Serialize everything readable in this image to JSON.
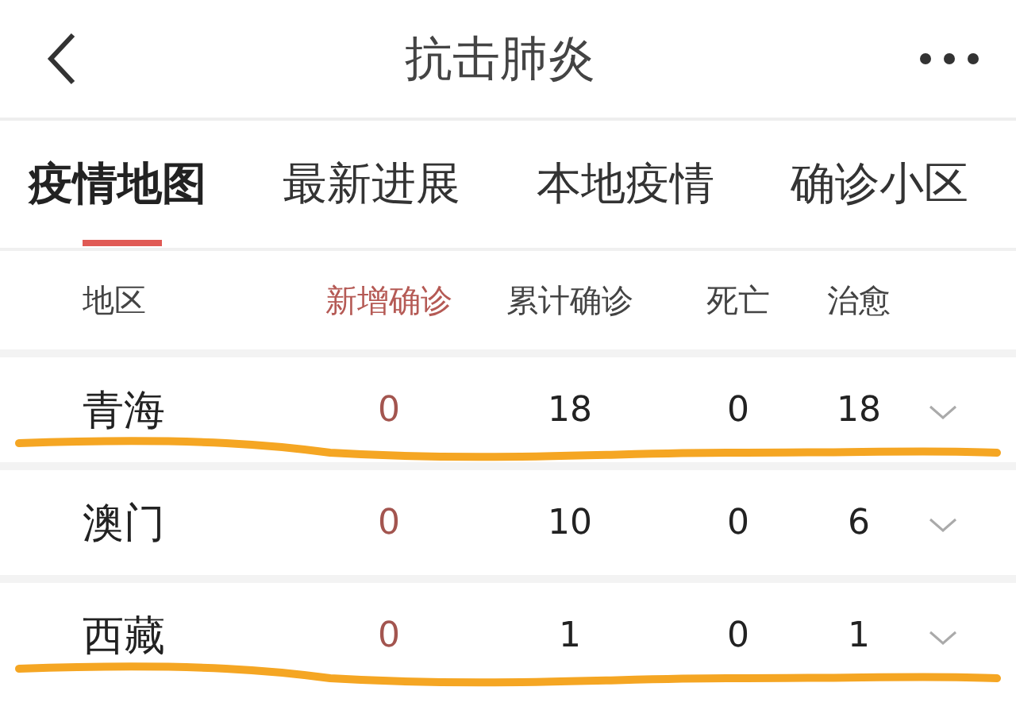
{
  "header": {
    "title": "抗击肺炎"
  },
  "tabs": [
    {
      "label": "疫情地图",
      "selected": true
    },
    {
      "label": "最新进展",
      "selected": false
    },
    {
      "label": "本地疫情",
      "selected": false
    },
    {
      "label": "确诊小区",
      "selected": false
    }
  ],
  "table": {
    "columns": [
      {
        "label": "地区",
        "kind": "plain"
      },
      {
        "label": "新增确诊",
        "kind": "highlight"
      },
      {
        "label": "累计确诊",
        "kind": "plain"
      },
      {
        "label": "死亡",
        "kind": "plain"
      },
      {
        "label": "治愈",
        "kind": "plain"
      }
    ],
    "rows": [
      {
        "region": "青海",
        "new": "0",
        "total": "18",
        "deaths": "0",
        "cured": "18",
        "underlined": true
      },
      {
        "region": "澳门",
        "new": "0",
        "total": "10",
        "deaths": "0",
        "cured": "6",
        "underlined": false
      },
      {
        "region": "西藏",
        "new": "0",
        "total": "1",
        "deaths": "0",
        "cured": "1",
        "underlined": true
      }
    ]
  }
}
